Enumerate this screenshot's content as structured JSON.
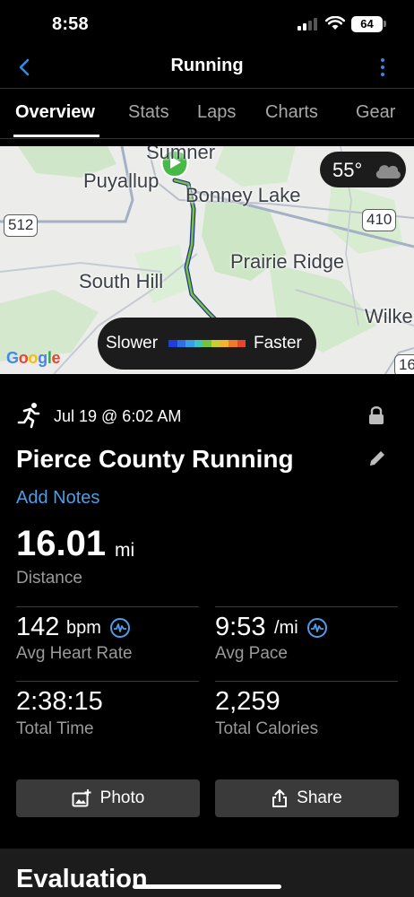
{
  "status_bar": {
    "time": "8:58",
    "battery": "64"
  },
  "nav": {
    "title": "Running",
    "back_icon": "chevron-left-icon",
    "more_icon": "more-vertical-icon",
    "accent_color": "#2f8be6"
  },
  "tabs": [
    {
      "label": "Overview",
      "active": true
    },
    {
      "label": "Stats",
      "active": false
    },
    {
      "label": "Laps",
      "active": false
    },
    {
      "label": "Charts",
      "active": false
    },
    {
      "label": "Gear",
      "active": false
    }
  ],
  "map": {
    "places": [
      "Sumner",
      "Puyallup",
      "Bonney Lake",
      "Prairie Ridge",
      "South Hill",
      "Wilke"
    ],
    "roads": [
      "512",
      "410",
      "16"
    ],
    "weather": {
      "temp": "55°",
      "icon": "cloud-icon"
    },
    "legend": {
      "slower": "Slower",
      "faster": "Faster"
    },
    "attribution": "Google"
  },
  "activity": {
    "icon": "running-icon",
    "date": "Jul 19 @ 6:02 AM",
    "title": "Pierce County Running",
    "add_notes": "Add Notes"
  },
  "stats": {
    "distance": {
      "value": "16.01",
      "unit": "mi",
      "label": "Distance"
    },
    "heart_rate": {
      "value": "142",
      "unit": "bpm",
      "label": "Avg Heart Rate"
    },
    "pace": {
      "value": "9:53",
      "unit": "/mi",
      "label": "Avg Pace"
    },
    "time": {
      "value": "2:38:15",
      "label": "Total Time"
    },
    "calories": {
      "value": "2,259",
      "label": "Total Calories"
    }
  },
  "actions": {
    "photo": "Photo",
    "share": "Share"
  },
  "evaluation": {
    "title": "Evaluation"
  }
}
